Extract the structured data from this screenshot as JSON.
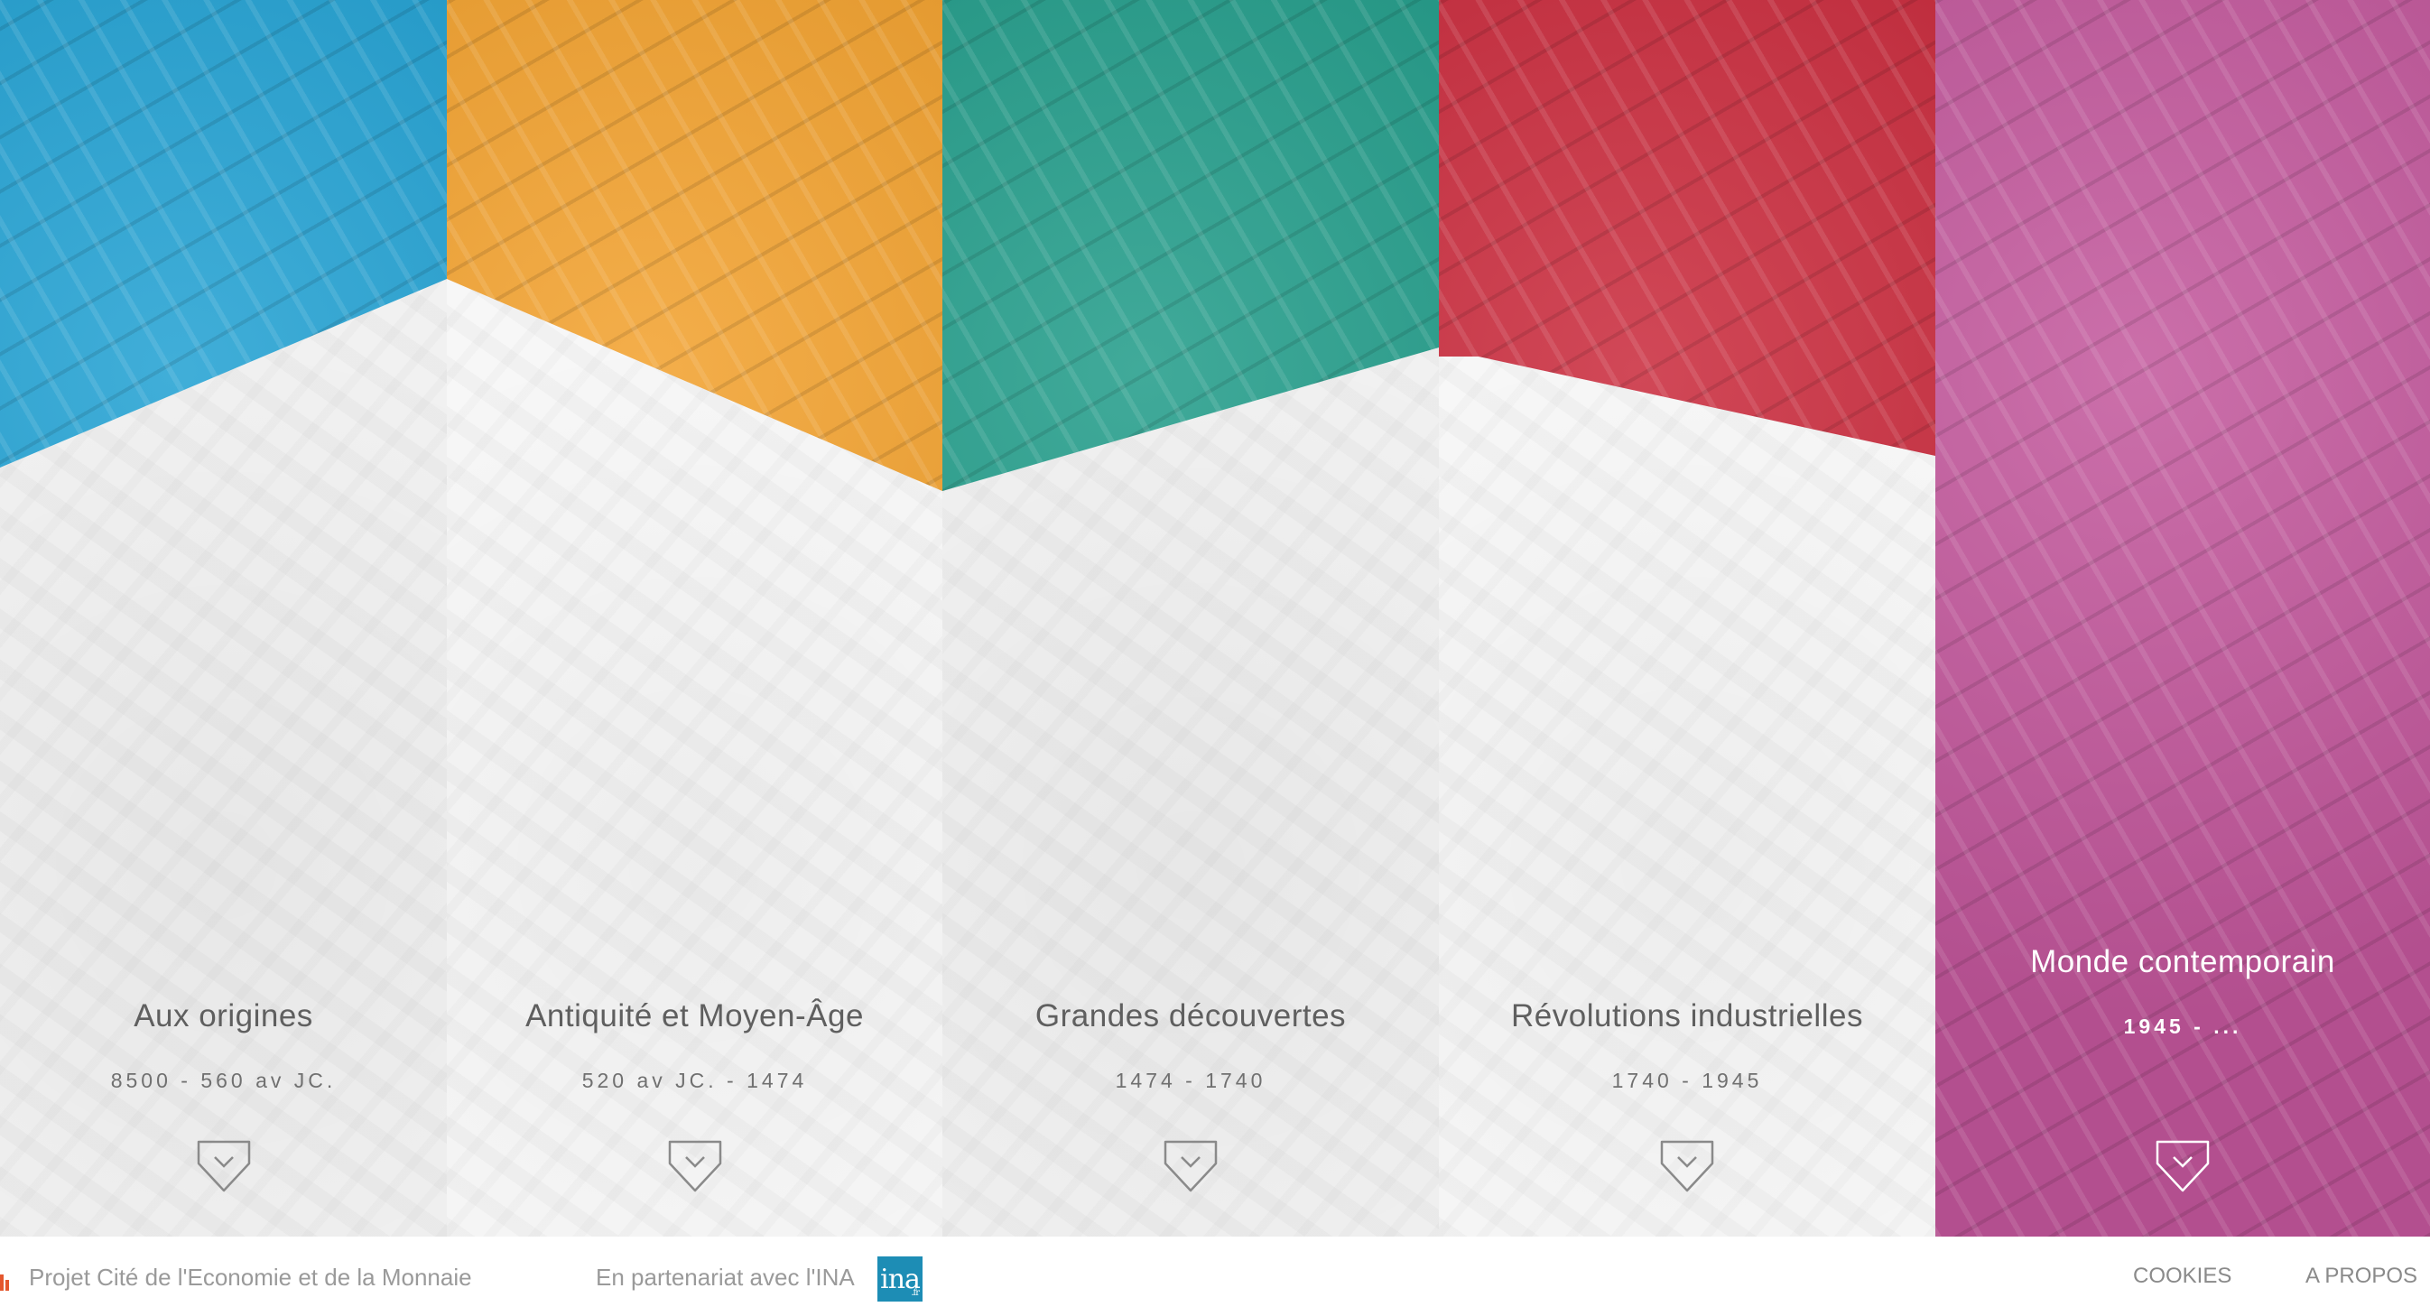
{
  "periods": [
    {
      "title": "Aux origines",
      "dates": "8500 - 560 av JC.",
      "color": "#1fa0d2"
    },
    {
      "title": "Antiquité et Moyen-Âge",
      "dates": "520 av JC. - 1474",
      "color": "#f2a02b"
    },
    {
      "title": "Grandes découvertes",
      "dates": "1474 - 1740",
      "color": "#1f9b88"
    },
    {
      "title": "Révolutions industrielles",
      "dates": "1740 - 1945",
      "color": "#c9283a"
    },
    {
      "title": "Monde contemporain",
      "dates": "1945 - ...",
      "color": "#c2569b"
    }
  ],
  "footer": {
    "project": "Projet Cité de l'Economie et de la Monnaie",
    "partner": "En partenariat avec l'INA",
    "ina_logo": "ina",
    "ina_logo_sub": ".fr",
    "cookies": "COOKIES",
    "apropos": "A PROPOS"
  },
  "icons": {
    "down": "chevron-down-pentagon-icon"
  }
}
